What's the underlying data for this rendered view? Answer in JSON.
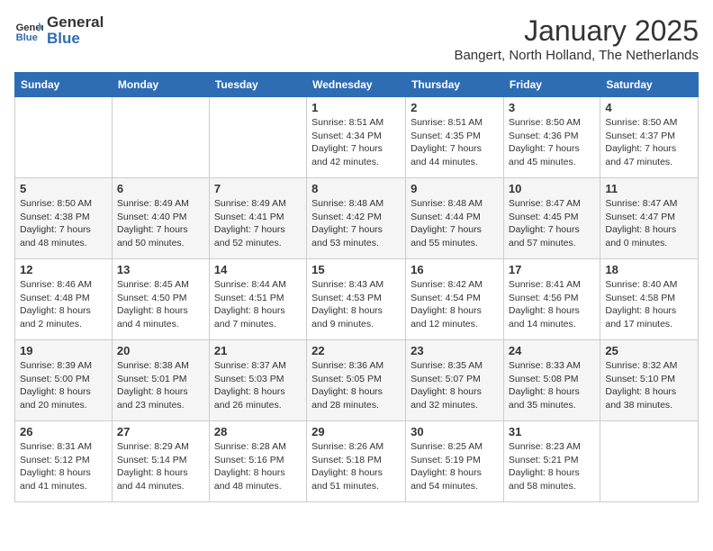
{
  "header": {
    "logo_general": "General",
    "logo_blue": "Blue",
    "title": "January 2025",
    "location": "Bangert, North Holland, The Netherlands"
  },
  "weekdays": [
    "Sunday",
    "Monday",
    "Tuesday",
    "Wednesday",
    "Thursday",
    "Friday",
    "Saturday"
  ],
  "weeks": [
    [
      {
        "day": "",
        "sunrise": "",
        "sunset": "",
        "daylight": ""
      },
      {
        "day": "",
        "sunrise": "",
        "sunset": "",
        "daylight": ""
      },
      {
        "day": "",
        "sunrise": "",
        "sunset": "",
        "daylight": ""
      },
      {
        "day": "1",
        "sunrise": "Sunrise: 8:51 AM",
        "sunset": "Sunset: 4:34 PM",
        "daylight": "Daylight: 7 hours and 42 minutes."
      },
      {
        "day": "2",
        "sunrise": "Sunrise: 8:51 AM",
        "sunset": "Sunset: 4:35 PM",
        "daylight": "Daylight: 7 hours and 44 minutes."
      },
      {
        "day": "3",
        "sunrise": "Sunrise: 8:50 AM",
        "sunset": "Sunset: 4:36 PM",
        "daylight": "Daylight: 7 hours and 45 minutes."
      },
      {
        "day": "4",
        "sunrise": "Sunrise: 8:50 AM",
        "sunset": "Sunset: 4:37 PM",
        "daylight": "Daylight: 7 hours and 47 minutes."
      }
    ],
    [
      {
        "day": "5",
        "sunrise": "Sunrise: 8:50 AM",
        "sunset": "Sunset: 4:38 PM",
        "daylight": "Daylight: 7 hours and 48 minutes."
      },
      {
        "day": "6",
        "sunrise": "Sunrise: 8:49 AM",
        "sunset": "Sunset: 4:40 PM",
        "daylight": "Daylight: 7 hours and 50 minutes."
      },
      {
        "day": "7",
        "sunrise": "Sunrise: 8:49 AM",
        "sunset": "Sunset: 4:41 PM",
        "daylight": "Daylight: 7 hours and 52 minutes."
      },
      {
        "day": "8",
        "sunrise": "Sunrise: 8:48 AM",
        "sunset": "Sunset: 4:42 PM",
        "daylight": "Daylight: 7 hours and 53 minutes."
      },
      {
        "day": "9",
        "sunrise": "Sunrise: 8:48 AM",
        "sunset": "Sunset: 4:44 PM",
        "daylight": "Daylight: 7 hours and 55 minutes."
      },
      {
        "day": "10",
        "sunrise": "Sunrise: 8:47 AM",
        "sunset": "Sunset: 4:45 PM",
        "daylight": "Daylight: 7 hours and 57 minutes."
      },
      {
        "day": "11",
        "sunrise": "Sunrise: 8:47 AM",
        "sunset": "Sunset: 4:47 PM",
        "daylight": "Daylight: 8 hours and 0 minutes."
      }
    ],
    [
      {
        "day": "12",
        "sunrise": "Sunrise: 8:46 AM",
        "sunset": "Sunset: 4:48 PM",
        "daylight": "Daylight: 8 hours and 2 minutes."
      },
      {
        "day": "13",
        "sunrise": "Sunrise: 8:45 AM",
        "sunset": "Sunset: 4:50 PM",
        "daylight": "Daylight: 8 hours and 4 minutes."
      },
      {
        "day": "14",
        "sunrise": "Sunrise: 8:44 AM",
        "sunset": "Sunset: 4:51 PM",
        "daylight": "Daylight: 8 hours and 7 minutes."
      },
      {
        "day": "15",
        "sunrise": "Sunrise: 8:43 AM",
        "sunset": "Sunset: 4:53 PM",
        "daylight": "Daylight: 8 hours and 9 minutes."
      },
      {
        "day": "16",
        "sunrise": "Sunrise: 8:42 AM",
        "sunset": "Sunset: 4:54 PM",
        "daylight": "Daylight: 8 hours and 12 minutes."
      },
      {
        "day": "17",
        "sunrise": "Sunrise: 8:41 AM",
        "sunset": "Sunset: 4:56 PM",
        "daylight": "Daylight: 8 hours and 14 minutes."
      },
      {
        "day": "18",
        "sunrise": "Sunrise: 8:40 AM",
        "sunset": "Sunset: 4:58 PM",
        "daylight": "Daylight: 8 hours and 17 minutes."
      }
    ],
    [
      {
        "day": "19",
        "sunrise": "Sunrise: 8:39 AM",
        "sunset": "Sunset: 5:00 PM",
        "daylight": "Daylight: 8 hours and 20 minutes."
      },
      {
        "day": "20",
        "sunrise": "Sunrise: 8:38 AM",
        "sunset": "Sunset: 5:01 PM",
        "daylight": "Daylight: 8 hours and 23 minutes."
      },
      {
        "day": "21",
        "sunrise": "Sunrise: 8:37 AM",
        "sunset": "Sunset: 5:03 PM",
        "daylight": "Daylight: 8 hours and 26 minutes."
      },
      {
        "day": "22",
        "sunrise": "Sunrise: 8:36 AM",
        "sunset": "Sunset: 5:05 PM",
        "daylight": "Daylight: 8 hours and 28 minutes."
      },
      {
        "day": "23",
        "sunrise": "Sunrise: 8:35 AM",
        "sunset": "Sunset: 5:07 PM",
        "daylight": "Daylight: 8 hours and 32 minutes."
      },
      {
        "day": "24",
        "sunrise": "Sunrise: 8:33 AM",
        "sunset": "Sunset: 5:08 PM",
        "daylight": "Daylight: 8 hours and 35 minutes."
      },
      {
        "day": "25",
        "sunrise": "Sunrise: 8:32 AM",
        "sunset": "Sunset: 5:10 PM",
        "daylight": "Daylight: 8 hours and 38 minutes."
      }
    ],
    [
      {
        "day": "26",
        "sunrise": "Sunrise: 8:31 AM",
        "sunset": "Sunset: 5:12 PM",
        "daylight": "Daylight: 8 hours and 41 minutes."
      },
      {
        "day": "27",
        "sunrise": "Sunrise: 8:29 AM",
        "sunset": "Sunset: 5:14 PM",
        "daylight": "Daylight: 8 hours and 44 minutes."
      },
      {
        "day": "28",
        "sunrise": "Sunrise: 8:28 AM",
        "sunset": "Sunset: 5:16 PM",
        "daylight": "Daylight: 8 hours and 48 minutes."
      },
      {
        "day": "29",
        "sunrise": "Sunrise: 8:26 AM",
        "sunset": "Sunset: 5:18 PM",
        "daylight": "Daylight: 8 hours and 51 minutes."
      },
      {
        "day": "30",
        "sunrise": "Sunrise: 8:25 AM",
        "sunset": "Sunset: 5:19 PM",
        "daylight": "Daylight: 8 hours and 54 minutes."
      },
      {
        "day": "31",
        "sunrise": "Sunrise: 8:23 AM",
        "sunset": "Sunset: 5:21 PM",
        "daylight": "Daylight: 8 hours and 58 minutes."
      },
      {
        "day": "",
        "sunrise": "",
        "sunset": "",
        "daylight": ""
      }
    ]
  ]
}
